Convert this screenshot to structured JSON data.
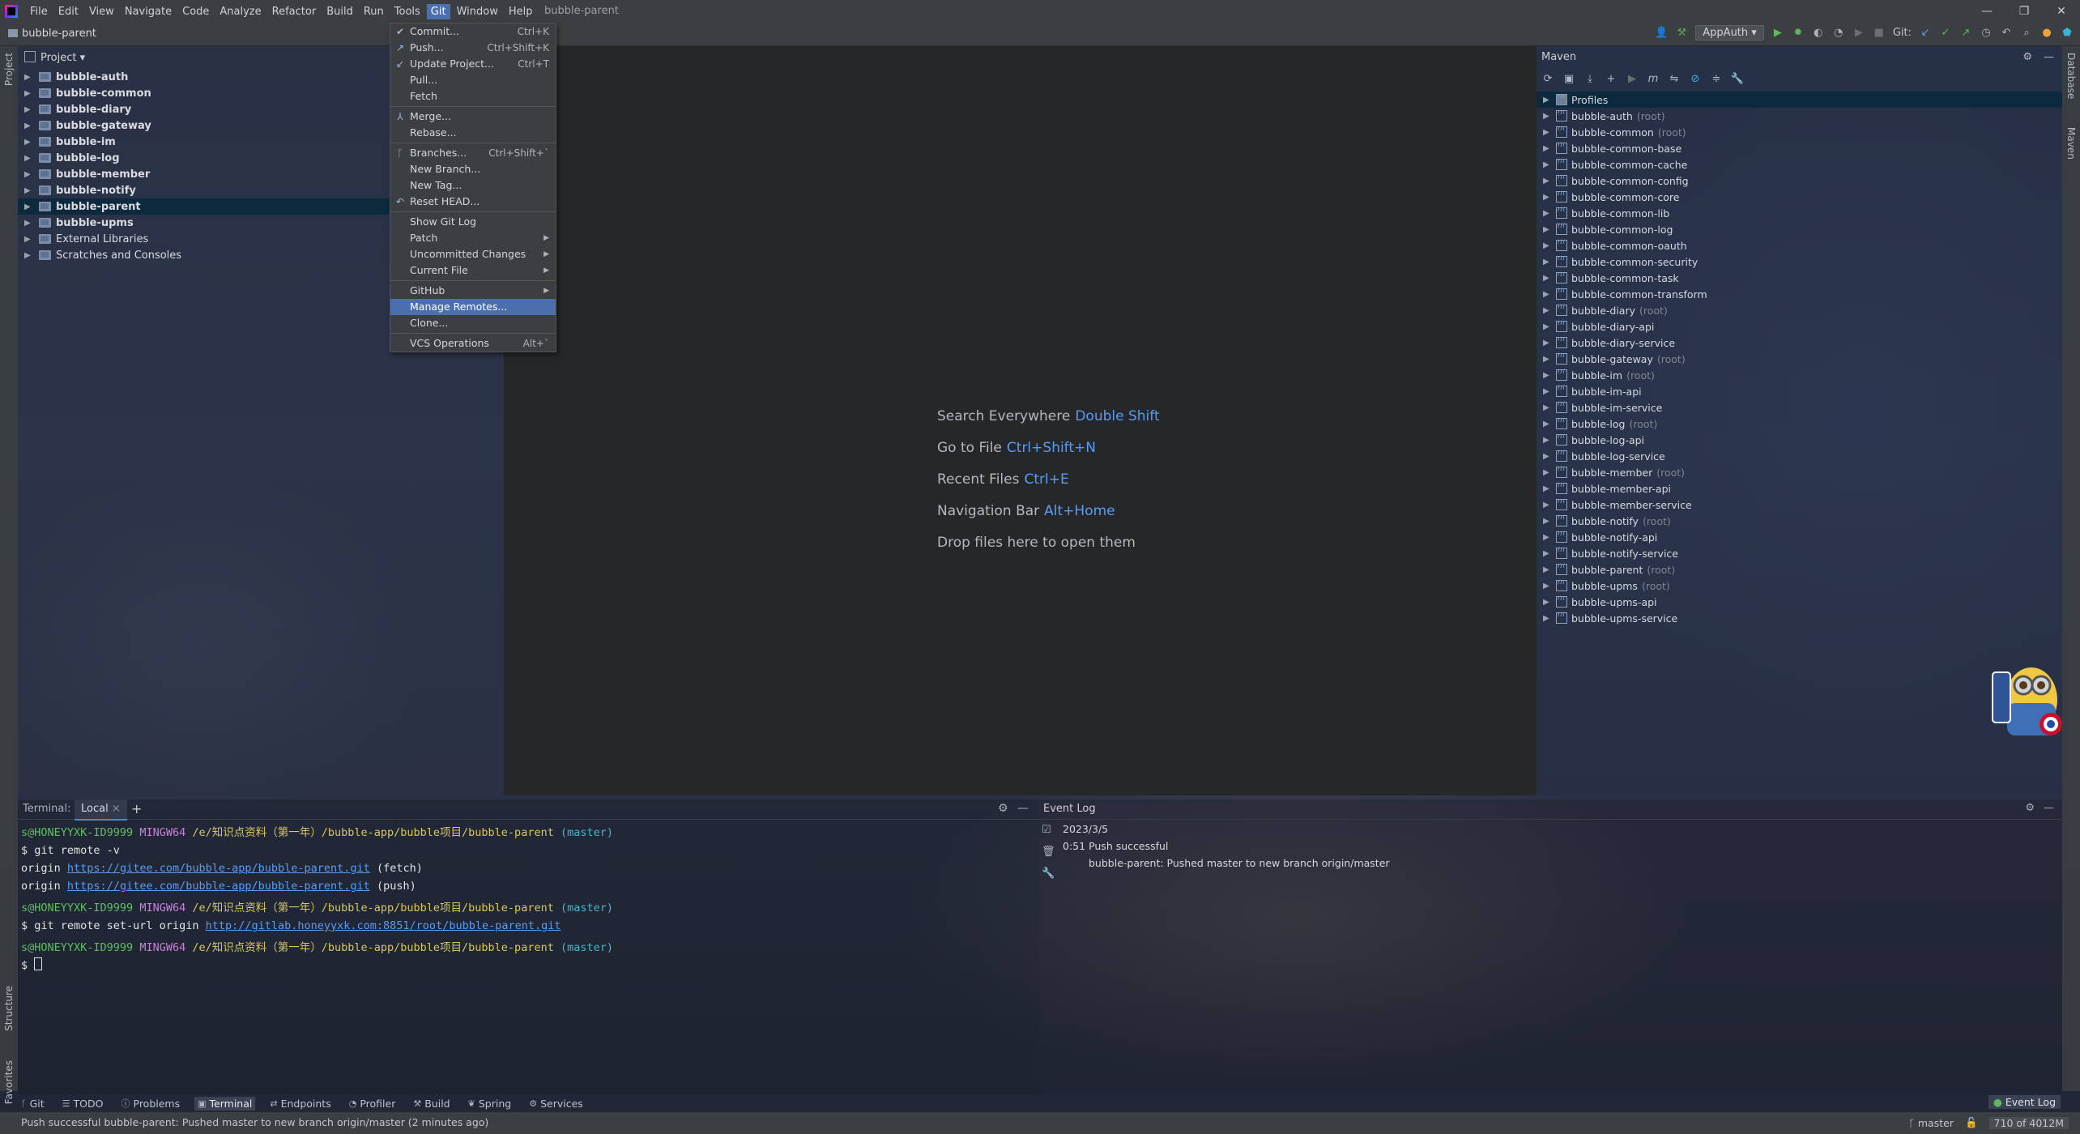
{
  "menubar": {
    "items": [
      "File",
      "Edit",
      "View",
      "Navigate",
      "Code",
      "Analyze",
      "Refactor",
      "Build",
      "Run",
      "Tools",
      "Git",
      "Window",
      "Help"
    ],
    "project_title": "bubble-parent",
    "window_controls": [
      "—",
      "❐",
      "✕"
    ]
  },
  "toolbar": {
    "breadcrumb": "bubble-parent",
    "run_config": "AppAuth",
    "git_label": "Git:"
  },
  "side": {
    "left_project": "Project",
    "left_structure": "Structure",
    "left_favorites": "Favorites",
    "right_database": "Database",
    "right_maven": "Maven"
  },
  "project_panel": {
    "title": "Project",
    "items": [
      {
        "label": "bubble-auth",
        "bold": true
      },
      {
        "label": "bubble-common",
        "bold": true
      },
      {
        "label": "bubble-diary",
        "bold": true
      },
      {
        "label": "bubble-gateway",
        "bold": true
      },
      {
        "label": "bubble-im",
        "bold": true
      },
      {
        "label": "bubble-log",
        "bold": true
      },
      {
        "label": "bubble-member",
        "bold": true
      },
      {
        "label": "bubble-notify",
        "bold": true
      },
      {
        "label": "bubble-parent",
        "bold": true,
        "selected": true
      },
      {
        "label": "bubble-upms",
        "bold": true
      },
      {
        "label": "External Libraries",
        "bold": false
      },
      {
        "label": "Scratches and Consoles",
        "bold": false
      }
    ]
  },
  "git_menu": {
    "items": [
      {
        "label": "Commit...",
        "shortcut": "Ctrl+K",
        "icon": "check-icon"
      },
      {
        "label": "Push...",
        "shortcut": "Ctrl+Shift+K",
        "icon": "push-arrow-icon"
      },
      {
        "label": "Update Project...",
        "shortcut": "Ctrl+T",
        "icon": "update-arrow-icon"
      },
      {
        "label": "Pull..."
      },
      {
        "label": "Fetch"
      },
      {
        "sep": true
      },
      {
        "label": "Merge...",
        "icon": "merge-icon"
      },
      {
        "label": "Rebase..."
      },
      {
        "sep": true
      },
      {
        "label": "Branches...",
        "shortcut": "Ctrl+Shift+`",
        "icon": "branch-icon"
      },
      {
        "label": "New Branch..."
      },
      {
        "label": "New Tag..."
      },
      {
        "label": "Reset HEAD...",
        "icon": "reset-icon"
      },
      {
        "sep": true
      },
      {
        "label": "Show Git Log"
      },
      {
        "label": "Patch",
        "submenu": true
      },
      {
        "label": "Uncommitted Changes",
        "submenu": true
      },
      {
        "label": "Current File",
        "submenu": true
      },
      {
        "sep": true
      },
      {
        "label": "GitHub",
        "submenu": true
      },
      {
        "label": "Manage Remotes...",
        "selected": true
      },
      {
        "label": "Clone..."
      },
      {
        "sep": true
      },
      {
        "label": "VCS Operations",
        "shortcut": "Alt+`"
      }
    ]
  },
  "editor": {
    "hints": [
      {
        "label": "Search Everywhere",
        "key": "Double Shift"
      },
      {
        "label": "Go to File",
        "key": "Ctrl+Shift+N"
      },
      {
        "label": "Recent Files",
        "key": "Ctrl+E"
      },
      {
        "label": "Navigation Bar",
        "key": "Alt+Home"
      },
      {
        "label": "Drop files here to open them",
        "key": ""
      }
    ]
  },
  "maven": {
    "title": "Maven",
    "items": [
      {
        "label": "Profiles",
        "root": false,
        "selected": true,
        "kind": "folder"
      },
      {
        "label": "bubble-auth",
        "root": true
      },
      {
        "label": "bubble-common",
        "root": true
      },
      {
        "label": "bubble-common-base",
        "root": false
      },
      {
        "label": "bubble-common-cache",
        "root": false
      },
      {
        "label": "bubble-common-config",
        "root": false
      },
      {
        "label": "bubble-common-core",
        "root": false
      },
      {
        "label": "bubble-common-lib",
        "root": false
      },
      {
        "label": "bubble-common-log",
        "root": false
      },
      {
        "label": "bubble-common-oauth",
        "root": false
      },
      {
        "label": "bubble-common-security",
        "root": false
      },
      {
        "label": "bubble-common-task",
        "root": false
      },
      {
        "label": "bubble-common-transform",
        "root": false
      },
      {
        "label": "bubble-diary",
        "root": true
      },
      {
        "label": "bubble-diary-api",
        "root": false
      },
      {
        "label": "bubble-diary-service",
        "root": false
      },
      {
        "label": "bubble-gateway",
        "root": true
      },
      {
        "label": "bubble-im",
        "root": true
      },
      {
        "label": "bubble-im-api",
        "root": false
      },
      {
        "label": "bubble-im-service",
        "root": false
      },
      {
        "label": "bubble-log",
        "root": true
      },
      {
        "label": "bubble-log-api",
        "root": false
      },
      {
        "label": "bubble-log-service",
        "root": false
      },
      {
        "label": "bubble-member",
        "root": true
      },
      {
        "label": "bubble-member-api",
        "root": false
      },
      {
        "label": "bubble-member-service",
        "root": false
      },
      {
        "label": "bubble-notify",
        "root": true
      },
      {
        "label": "bubble-notify-api",
        "root": false
      },
      {
        "label": "bubble-notify-service",
        "root": false
      },
      {
        "label": "bubble-parent",
        "root": true
      },
      {
        "label": "bubble-upms",
        "root": true
      },
      {
        "label": "bubble-upms-api",
        "root": false
      },
      {
        "label": "bubble-upms-service",
        "root": false
      }
    ],
    "root_suffix": "(root)"
  },
  "terminal": {
    "label": "Terminal:",
    "tab": "Local",
    "prompt_user": "s@HONEYYXK-ID9999",
    "prompt_shell": "MINGW64",
    "prompt_path": "/e/知识点资料（第一年）/bubble-app/bubble项目/bubble-parent",
    "prompt_branch": "(master)",
    "cmd1": "$ git remote -v",
    "origin_label": "origin",
    "remote_url": "https://gitee.com/bubble-app/bubble-parent.git",
    "fetch": "(fetch)",
    "push": "(push)",
    "cmd2": "$ git remote set-url origin",
    "new_url": "http://gitlab.honeyyxk.com:8851/root/bubble-parent.git",
    "prompt_char": "$"
  },
  "event_log": {
    "title": "Event Log",
    "date": "2023/3/5",
    "time": "0:51",
    "event": "Push successful",
    "detail": "bubble-parent: Pushed master to new branch origin/master"
  },
  "tool_tabs": [
    {
      "label": "Git",
      "icon": "branch-icon"
    },
    {
      "label": "TODO",
      "icon": "list-icon"
    },
    {
      "label": "Problems",
      "icon": "info-icon"
    },
    {
      "label": "Terminal",
      "icon": "terminal-icon",
      "active": true
    },
    {
      "label": "Endpoints",
      "icon": "endpoints-icon"
    },
    {
      "label": "Profiler",
      "icon": "profiler-icon"
    },
    {
      "label": "Build",
      "icon": "hammer-icon"
    },
    {
      "label": "Spring",
      "icon": "spring-icon"
    },
    {
      "label": "Services",
      "icon": "services-icon"
    }
  ],
  "event_log_tab": "Event Log",
  "status": {
    "message": "Push successful bubble-parent: Pushed master to new branch origin/master (2 minutes ago)",
    "branch": "master",
    "memory": "710 of 4012M"
  },
  "colors": {
    "accent": "#4b6eaf",
    "selection": "#0d293e",
    "link": "#589df6"
  }
}
